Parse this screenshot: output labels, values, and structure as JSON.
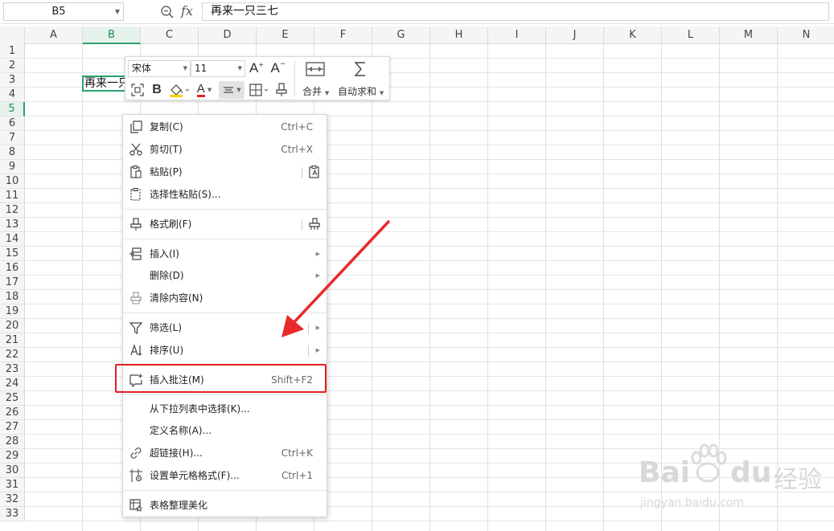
{
  "formula_bar": {
    "name_box": "B5",
    "fx_label": "fx",
    "formula_value": "再来一只三七"
  },
  "columns": [
    "A",
    "B",
    "C",
    "D",
    "E",
    "F",
    "G",
    "H",
    "I",
    "J",
    "K",
    "L",
    "M",
    "N"
  ],
  "selected_column": "B",
  "rows": [
    "1",
    "2",
    "3",
    "4",
    "5",
    "6",
    "7",
    "8",
    "9",
    "10",
    "11",
    "12",
    "13",
    "14",
    "15",
    "16",
    "17",
    "18",
    "19",
    "20",
    "21",
    "22",
    "23",
    "24",
    "25",
    "26",
    "27",
    "28",
    "29",
    "30",
    "31",
    "32",
    "33"
  ],
  "selected_row": "5",
  "cell_b5_text": "再来一只三七",
  "mini_toolbar": {
    "font_name": "宋体",
    "font_size": "11",
    "bold_label": "B",
    "font_color_label": "A",
    "grow_label": "A",
    "shrink_label": "A",
    "merge_label": "合并",
    "autosum_label": "自动求和"
  },
  "context_menu": {
    "copy": {
      "label": "复制(C)",
      "shortcut": "Ctrl+C"
    },
    "cut": {
      "label": "剪切(T)",
      "shortcut": "Ctrl+X"
    },
    "paste": {
      "label": "粘贴(P)"
    },
    "paste_special": {
      "label": "选择性粘贴(S)..."
    },
    "format_painter": {
      "label": "格式刷(F)"
    },
    "insert": {
      "label": "插入(I)"
    },
    "delete": {
      "label": "删除(D)"
    },
    "clear_contents": {
      "label": "清除内容(N)"
    },
    "filter": {
      "label": "筛选(L)"
    },
    "sort": {
      "label": "排序(U)"
    },
    "insert_comment": {
      "label": "插入批注(M)",
      "shortcut": "Shift+F2"
    },
    "pick_from_list": {
      "label": "从下拉列表中选择(K)..."
    },
    "define_name": {
      "label": "定义名称(A)..."
    },
    "hyperlink": {
      "label": "超链接(H)...",
      "shortcut": "Ctrl+K"
    },
    "format_cells": {
      "label": "设置单元格格式(F)...",
      "shortcut": "Ctrl+1"
    },
    "beautify": {
      "label": "表格整理美化"
    }
  },
  "watermark": {
    "brand": "Bai",
    "brand2": "du",
    "suffix": "经验",
    "url": "jingyan.baidu.com"
  },
  "colors": {
    "accent_green": "#2aa06a",
    "highlight_red": "#e02020"
  }
}
